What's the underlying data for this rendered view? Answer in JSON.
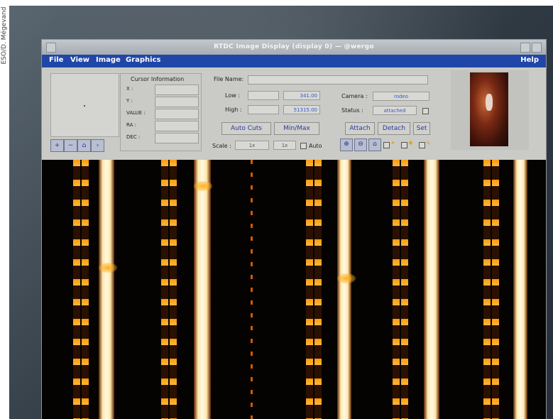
{
  "credit": "ESO/D. Mégevand",
  "window": {
    "title": "RTDC Image Display (display 0) — @wergo",
    "menus": [
      "File",
      "View",
      "Image",
      "Graphics"
    ],
    "help": "Help"
  },
  "cursor_info": {
    "title": "Cursor Information",
    "labels": [
      "X :",
      "Y :",
      "VALUE :",
      "RA :",
      "DEC :"
    ]
  },
  "controls": {
    "file_name_label": "File Name:",
    "low_label": "Low :",
    "low_value": "341.00",
    "high_label": "High :",
    "high_value": "51315.00",
    "autocuts_label": "Auto Cuts",
    "minmax_label": "Min/Max",
    "camera_label": "Camera :",
    "camera_value": "rodeo",
    "status_label": "Status :",
    "status_value": "attached",
    "attach_label": "Attach",
    "detach_label": "Detach",
    "set_label": "Set",
    "scale_label": "Scale :",
    "scale_x": "1x",
    "scale_y": "1x",
    "auto_label": "Auto"
  }
}
